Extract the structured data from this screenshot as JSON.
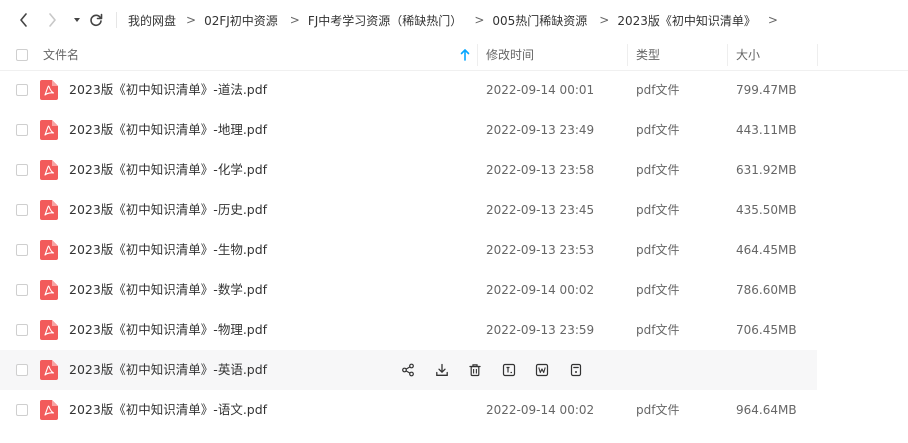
{
  "breadcrumb": [
    "我的网盘",
    "02FJ初中资源",
    "FJ中考学习资源（稀缺热门）",
    "005热门稀缺资源",
    "2023版《初中知识清单》"
  ],
  "breadcrumb_separator": ">",
  "columns": {
    "name": "文件名",
    "modified": "修改时间",
    "type": "类型",
    "size": "大小"
  },
  "files": [
    {
      "name": "2023版《初中知识清单》-道法.pdf",
      "modified": "2022-09-14 00:01",
      "type": "pdf文件",
      "size": "799.47MB"
    },
    {
      "name": "2023版《初中知识清单》-地理.pdf",
      "modified": "2022-09-13 23:49",
      "type": "pdf文件",
      "size": "443.11MB"
    },
    {
      "name": "2023版《初中知识清单》-化学.pdf",
      "modified": "2022-09-13 23:58",
      "type": "pdf文件",
      "size": "631.92MB"
    },
    {
      "name": "2023版《初中知识清单》-历史.pdf",
      "modified": "2022-09-13 23:45",
      "type": "pdf文件",
      "size": "435.50MB"
    },
    {
      "name": "2023版《初中知识清单》-生物.pdf",
      "modified": "2022-09-13 23:53",
      "type": "pdf文件",
      "size": "464.45MB"
    },
    {
      "name": "2023版《初中知识清单》-数学.pdf",
      "modified": "2022-09-14 00:02",
      "type": "pdf文件",
      "size": "786.60MB"
    },
    {
      "name": "2023版《初中知识清单》-物理.pdf",
      "modified": "2022-09-13 23:59",
      "type": "pdf文件",
      "size": "706.45MB"
    },
    {
      "name": "2023版《初中知识清单》-英语.pdf",
      "modified": "",
      "type": "",
      "size": "",
      "hovered": true
    },
    {
      "name": "2023版《初中知识清单》-语文.pdf",
      "modified": "2022-09-14 00:02",
      "type": "pdf文件",
      "size": "964.64MB"
    }
  ],
  "row_actions": [
    "share-icon",
    "download-icon",
    "delete-icon",
    "rename-icon",
    "open-word-icon",
    "more-icon"
  ],
  "colors": {
    "accent": "#06a7ff",
    "pdf_red": "#f25b5b",
    "hover_bg": "#f7f7f8"
  }
}
